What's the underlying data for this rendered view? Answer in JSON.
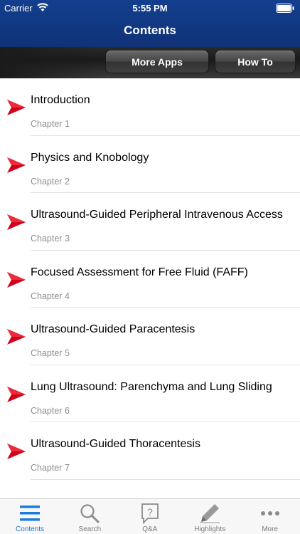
{
  "status": {
    "carrier": "Carrier",
    "time": "5:55 PM"
  },
  "nav": {
    "title": "Contents"
  },
  "toolbar": {
    "more_apps": "More Apps",
    "how_to": "How To"
  },
  "chapters": [
    {
      "title": "Introduction",
      "sub": "Chapter 1"
    },
    {
      "title": "Physics and Knobology",
      "sub": "Chapter 2"
    },
    {
      "title": "Ultrasound-Guided Peripheral Intravenous Access",
      "sub": "Chapter 3"
    },
    {
      "title": "Focused Assessment for Free Fluid (FAFF)",
      "sub": "Chapter 4"
    },
    {
      "title": "Ultrasound-Guided Paracentesis",
      "sub": "Chapter 5"
    },
    {
      "title": "Lung Ultrasound: Parenchyma and Lung Sliding",
      "sub": "Chapter 6"
    },
    {
      "title": "Ultrasound-Guided Thoracentesis",
      "sub": "Chapter 7"
    },
    {
      "title": "",
      "sub": ""
    }
  ],
  "tabs": [
    {
      "label": "Contents",
      "icon": "list-icon",
      "active": true
    },
    {
      "label": "Search",
      "icon": "search-icon",
      "active": false
    },
    {
      "label": "Q&A",
      "icon": "question-icon",
      "active": false
    },
    {
      "label": "Highlights",
      "icon": "pen-icon",
      "active": false
    },
    {
      "label": "More",
      "icon": "ellipsis-icon",
      "active": false
    }
  ],
  "colors": {
    "nav": "#143f8e",
    "accent": "#1a7be0",
    "arrow": "#d0021b"
  }
}
